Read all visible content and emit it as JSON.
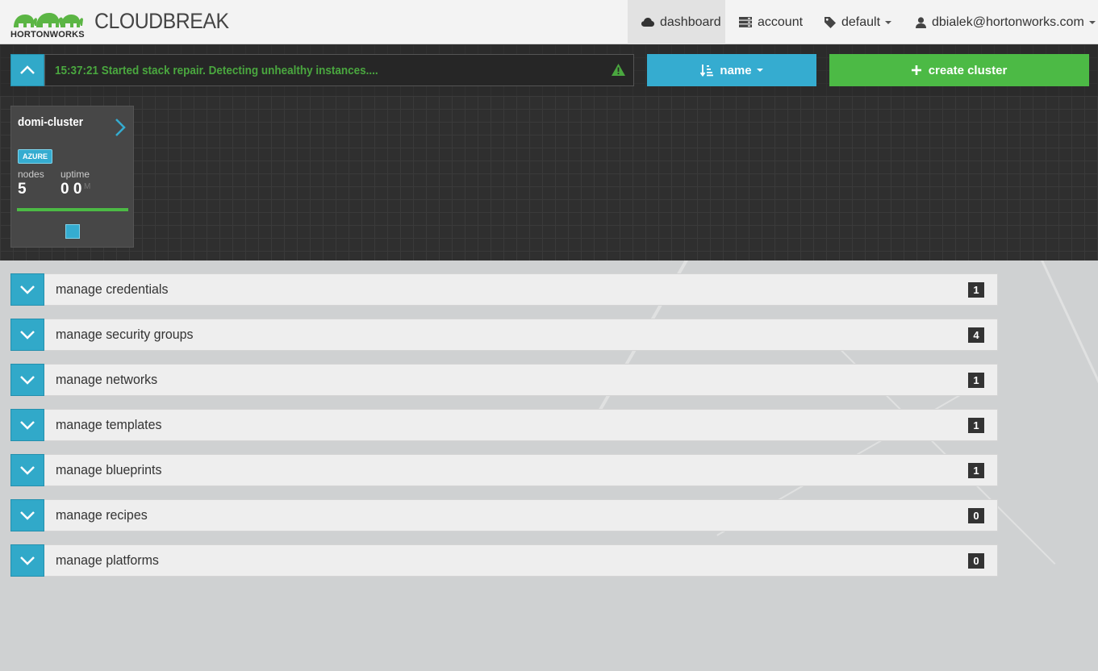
{
  "header": {
    "logo_text": "HORTONWORKS",
    "brand": "CLOUDBREAK",
    "nav": [
      {
        "label": "dashboard",
        "icon": "cloud-icon",
        "active": true
      },
      {
        "label": "account",
        "icon": "server-icon",
        "active": false
      },
      {
        "label": "default",
        "icon": "tag-icon",
        "active": false
      },
      {
        "label": "dbialek@hortonworks.com",
        "icon": "user-icon",
        "active": false
      }
    ]
  },
  "toolbar": {
    "status_message": "15:37:21 Started stack repair. Detecting unhealthy instances....",
    "sort_label": "name",
    "create_label": "create cluster"
  },
  "cluster": {
    "name": "domi-cluster",
    "provider": "AZURE",
    "nodes_label": "nodes",
    "nodes_value": "5",
    "uptime_label": "uptime",
    "uptime_value": "0 0",
    "uptime_ghost": "M",
    "health_fraction": 1.0
  },
  "sections": [
    {
      "label": "manage credentials",
      "count": "1"
    },
    {
      "label": "manage security groups",
      "count": "4"
    },
    {
      "label": "manage networks",
      "count": "1"
    },
    {
      "label": "manage templates",
      "count": "1"
    },
    {
      "label": "manage blueprints",
      "count": "1"
    },
    {
      "label": "manage recipes",
      "count": "0"
    },
    {
      "label": "manage platforms",
      "count": "0"
    }
  ],
  "colors": {
    "accent": "#35acd0",
    "success": "#4cba45",
    "status_text": "#4aa73f",
    "dark_bg": "#2f2f2f"
  }
}
